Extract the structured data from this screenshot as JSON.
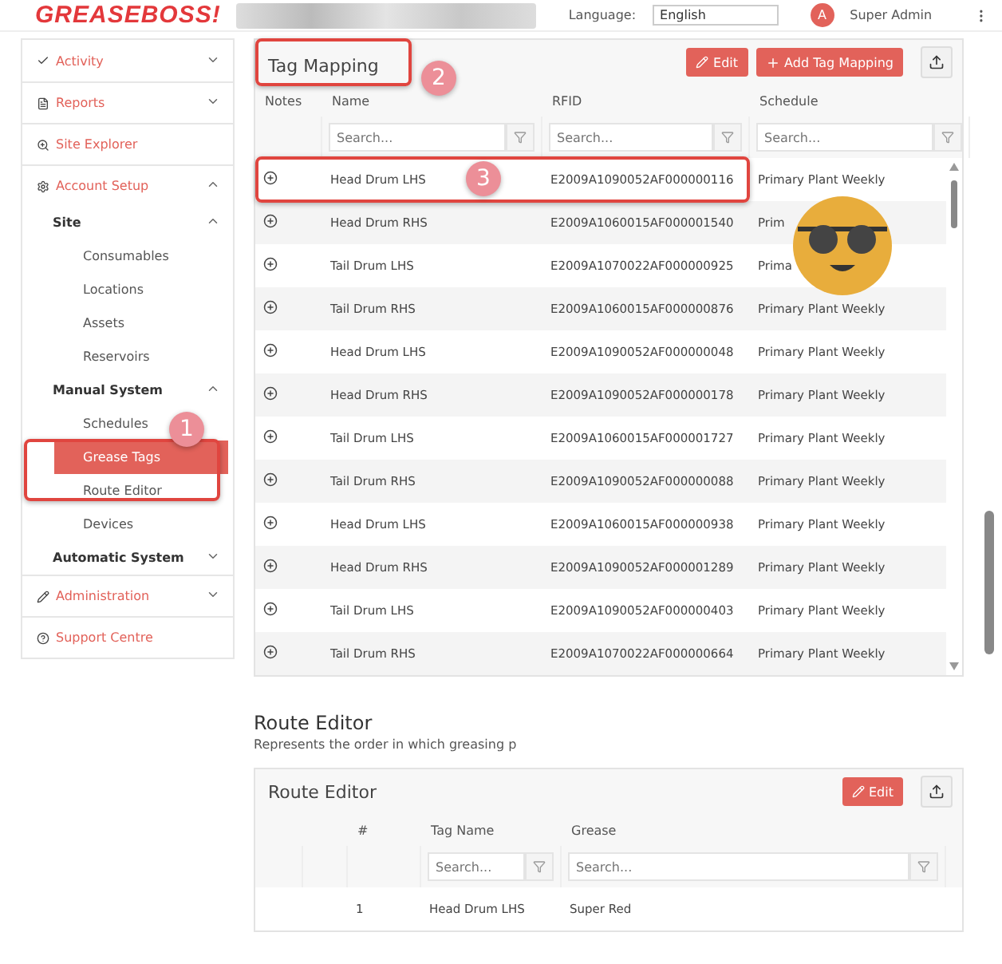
{
  "header": {
    "logo": "GREASEBOSS!",
    "language_label": "Language:",
    "language_value": "English",
    "avatar": "A",
    "user_role": "Super Admin"
  },
  "sidebar": {
    "items": [
      {
        "label": "Activity",
        "expanded": false
      },
      {
        "label": "Reports",
        "expanded": false
      },
      {
        "label": "Site Explorer"
      },
      {
        "label": "Account Setup",
        "expanded": true,
        "children": [
          {
            "label": "Site",
            "expanded": true,
            "children": [
              {
                "label": "Consumables",
                "selected": false
              },
              {
                "label": "Locations",
                "selected": false
              },
              {
                "label": "Assets",
                "selected": false
              },
              {
                "label": "Reservoirs",
                "selected": false
              }
            ]
          },
          {
            "label": "Manual System",
            "expanded": true,
            "children": [
              {
                "label": "Schedules",
                "selected": false
              },
              {
                "label": "Grease Tags",
                "selected": true,
                "callout": "1"
              },
              {
                "label": "Route Editor",
                "selected": false
              },
              {
                "label": "Devices",
                "selected": false
              }
            ]
          },
          {
            "label": "Automatic System",
            "expanded": false
          }
        ]
      },
      {
        "label": "Administration",
        "expanded": false
      },
      {
        "label": "Support Centre"
      }
    ]
  },
  "tag_mapping": {
    "title": "Tag Mapping",
    "title_callout": "2",
    "buttons": [
      {
        "kind": "edit",
        "label": "Edit"
      },
      {
        "kind": "add",
        "label": "Add Tag Mapping"
      },
      {
        "kind": "export"
      }
    ],
    "columns": [
      {
        "label": "Notes"
      },
      {
        "label": "Name",
        "placeholder": "Search..."
      },
      {
        "label": "RFID",
        "placeholder": "Search..."
      },
      {
        "label": "Schedule",
        "placeholder": "Search..."
      }
    ],
    "rows": [
      {
        "name": "Head Drum LHS",
        "rfid": "E2009A1090052AF000000116",
        "schedule": "Primary Plant Weekly",
        "callout": "3"
      },
      {
        "name": "Head Drum RHS",
        "rfid": "E2009A1060015AF000001540",
        "schedule": "Prim"
      },
      {
        "name": "Tail Drum LHS",
        "rfid": "E2009A1070022AF000000925",
        "schedule": "Prima"
      },
      {
        "name": "Tail Drum RHS",
        "rfid": "E2009A1060015AF000000876",
        "schedule": "Primary Plant Weekly"
      },
      {
        "name": "Head Drum LHS",
        "rfid": "E2009A1090052AF000000048",
        "schedule": "Primary Plant Weekly"
      },
      {
        "name": "Head Drum RHS",
        "rfid": "E2009A1090052AF000000178",
        "schedule": "Primary Plant Weekly"
      },
      {
        "name": "Tail Drum LHS",
        "rfid": "E2009A1060015AF000001727",
        "schedule": "Primary Plant Weekly"
      },
      {
        "name": "Tail Drum RHS",
        "rfid": "E2009A1090052AF000000088",
        "schedule": "Primary Plant Weekly"
      },
      {
        "name": "Head Drum LHS",
        "rfid": "E2009A1060015AF000000938",
        "schedule": "Primary Plant Weekly"
      },
      {
        "name": "Head Drum RHS",
        "rfid": "E2009A1090052AF000001289",
        "schedule": "Primary Plant Weekly"
      },
      {
        "name": "Tail Drum LHS",
        "rfid": "E2009A1090052AF000000403",
        "schedule": "Primary Plant Weekly"
      },
      {
        "name": "Tail Drum RHS",
        "rfid": "E2009A1070022AF000000664",
        "schedule": "Primary Plant Weekly"
      }
    ]
  },
  "route_editor": {
    "heading": "Route Editor",
    "description": "Represents the order in which greasing p",
    "title": "Route Editor",
    "buttons": [
      {
        "kind": "edit",
        "label": "Edit"
      },
      {
        "kind": "export"
      }
    ],
    "columns": [
      {
        "label": "#"
      },
      {
        "label": "Tag Name",
        "placeholder": "Search..."
      },
      {
        "label": "Grease",
        "placeholder": "Search..."
      }
    ],
    "rows": [
      {
        "number": "1",
        "tag_name": "Head Drum LHS",
        "grease": "Super Red"
      }
    ]
  }
}
